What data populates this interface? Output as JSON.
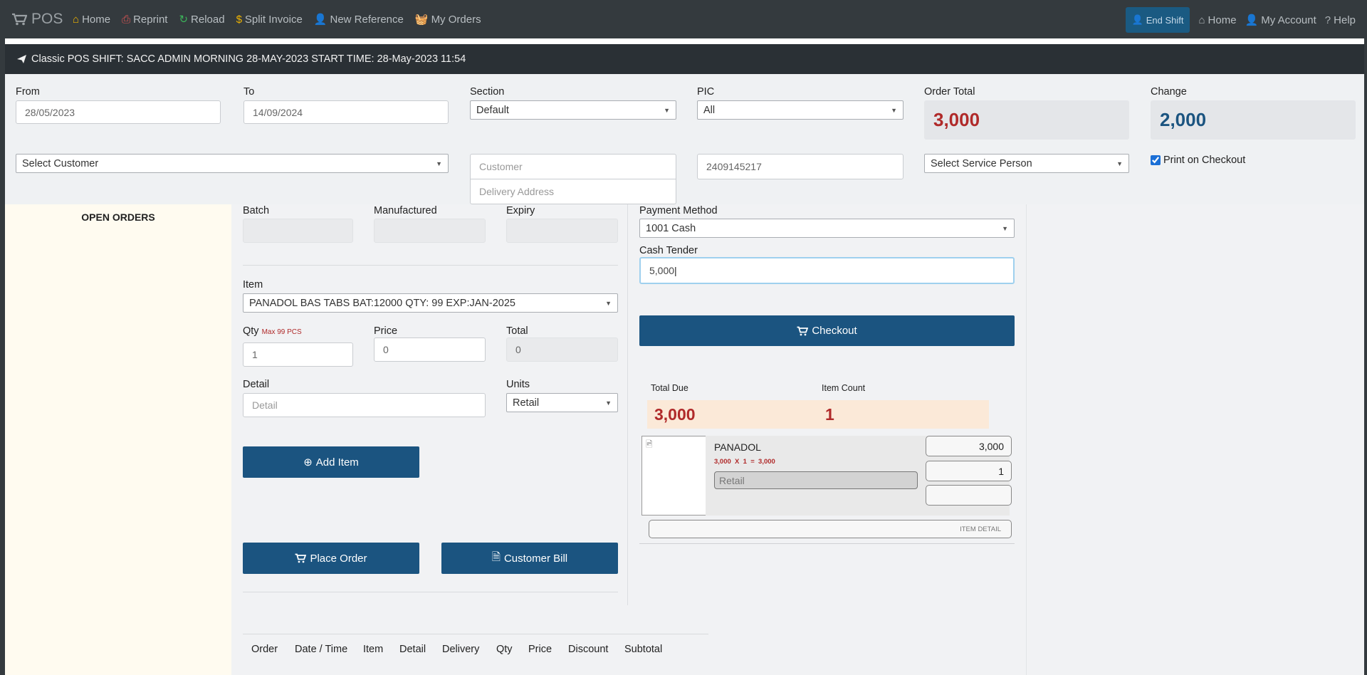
{
  "nav": {
    "brand": "POS",
    "left_links": [
      {
        "label": "Home",
        "icon": "home-icon"
      },
      {
        "label": "Reprint",
        "icon": "print-icon"
      },
      {
        "label": "Reload",
        "icon": "reload-icon"
      },
      {
        "label": "Split Invoice",
        "icon": "dollar-icon"
      },
      {
        "label": "New Reference",
        "icon": "user-plus-icon"
      },
      {
        "label": "My Orders",
        "icon": "basket-icon"
      }
    ],
    "end_shift": "End Shift",
    "right_links": [
      {
        "label": "Home",
        "icon": "home-icon"
      },
      {
        "label": "My Account",
        "icon": "user-icon"
      },
      {
        "label": "Help",
        "icon": "question-icon"
      }
    ]
  },
  "shift_bar": {
    "text": "Classic POS SHIFT: SACC ADMIN MORNING 28-MAY-2023 START TIME: 28-May-2023 11:54"
  },
  "filters": {
    "from_label": "From",
    "from_value": "28/05/2023",
    "to_label": "To",
    "to_value": "14/09/2024",
    "section_label": "Section",
    "section_value": "Default",
    "pic_label": "PIC",
    "pic_value": "All",
    "order_total_label": "Order Total",
    "order_total_value": "3,000",
    "change_label": "Change",
    "change_value": "2,000",
    "customer_select": "Select Customer",
    "customer_placeholder": "Customer",
    "delivery_placeholder": "Delivery Address",
    "phone_value": "2409145217",
    "service_person": "Select Service Person",
    "print_on_checkout": "Print on Checkout"
  },
  "open_orders": {
    "title": "OPEN ORDERS"
  },
  "item_form": {
    "batch_label": "Batch",
    "manufactured_label": "Manufactured",
    "expiry_label": "Expiry",
    "item_label": "Item",
    "item_value": "PANADOL BAS TABS BAT:12000 QTY: 99 EXP:JAN-2025",
    "qty_label": "Qty",
    "qty_max": "Max 99 PCS",
    "qty_value": "1",
    "price_label": "Price",
    "price_value": "0",
    "total_label": "Total",
    "total_value": "0",
    "detail_label": "Detail",
    "detail_placeholder": "Detail",
    "units_label": "Units",
    "units_value": "Retail",
    "add_item": "Add Item",
    "place_order": "Place Order",
    "customer_bill": "Customer Bill"
  },
  "payment": {
    "method_label": "Payment Method",
    "method_value": "1001 Cash",
    "cash_label": "Cash Tender",
    "cash_value": "5,000",
    "checkout": "Checkout",
    "total_due_label": "Total Due",
    "total_due_value": "3,000",
    "item_count_label": "Item Count",
    "item_count_value": "1"
  },
  "line_item": {
    "name": "PANADOL",
    "calc": "3,000  X  1  =  3,000",
    "unit": "Retail",
    "amount": "3,000",
    "qty": "1",
    "extra": "",
    "detail_button": "ITEM DETAIL"
  },
  "orders_table": {
    "headers": [
      "Order",
      "Date / Time",
      "Item",
      "Detail",
      "Delivery",
      "Qty",
      "Price",
      "Discount",
      "Subtotal"
    ]
  }
}
